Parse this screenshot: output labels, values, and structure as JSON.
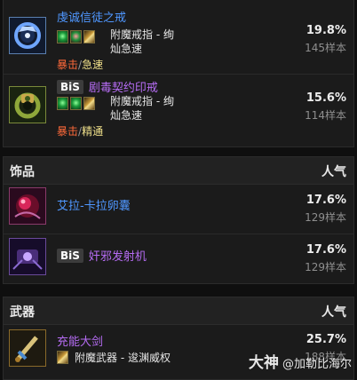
{
  "rings": {
    "items": [
      {
        "name": "虔诚信徒之戒",
        "bis": "",
        "enchant_lines": [
          "附魔戒指 - 绚",
          "灿急速"
        ],
        "stat_primary": "暴击",
        "stat_sep": "/",
        "stat_secondary": "急速",
        "percent": "19.8%",
        "samples": "145样本",
        "icon": "ring-icon"
      },
      {
        "name": "剧毒契约印戒",
        "bis": "BiS",
        "enchant_lines": [
          "附魔戒指 - 绚",
          "灿急速"
        ],
        "stat_primary": "暴击",
        "stat_sep": "/",
        "stat_secondary": "精通",
        "percent": "15.6%",
        "samples": "114样本",
        "icon": "signet-ring-icon"
      }
    ]
  },
  "trinkets": {
    "title": "饰品",
    "popularity_label": "人气",
    "items": [
      {
        "name": "艾拉-卡拉卵囊",
        "bis": "",
        "percent": "17.6%",
        "samples": "129样本",
        "icon": "egg-sac-icon"
      },
      {
        "name": "奸邪发射机",
        "bis": "BiS",
        "percent": "17.6%",
        "samples": "129样本",
        "icon": "launcher-icon"
      }
    ]
  },
  "weapons": {
    "title": "武器",
    "popularity_label": "人气",
    "items": [
      {
        "name": "充能大剑",
        "enchant": "附魔武器 - 逡渊威权",
        "percent": "25.7%",
        "samples": "188样本",
        "icon": "greatsword-icon"
      }
    ]
  },
  "watermark": {
    "brand": "大神",
    "handle": "@加勒比海尔"
  },
  "colors": {
    "epic": "#b56cf3",
    "rare": "#4f97ff",
    "crit": "#ff6a3a",
    "haste": "#f0e08a"
  }
}
